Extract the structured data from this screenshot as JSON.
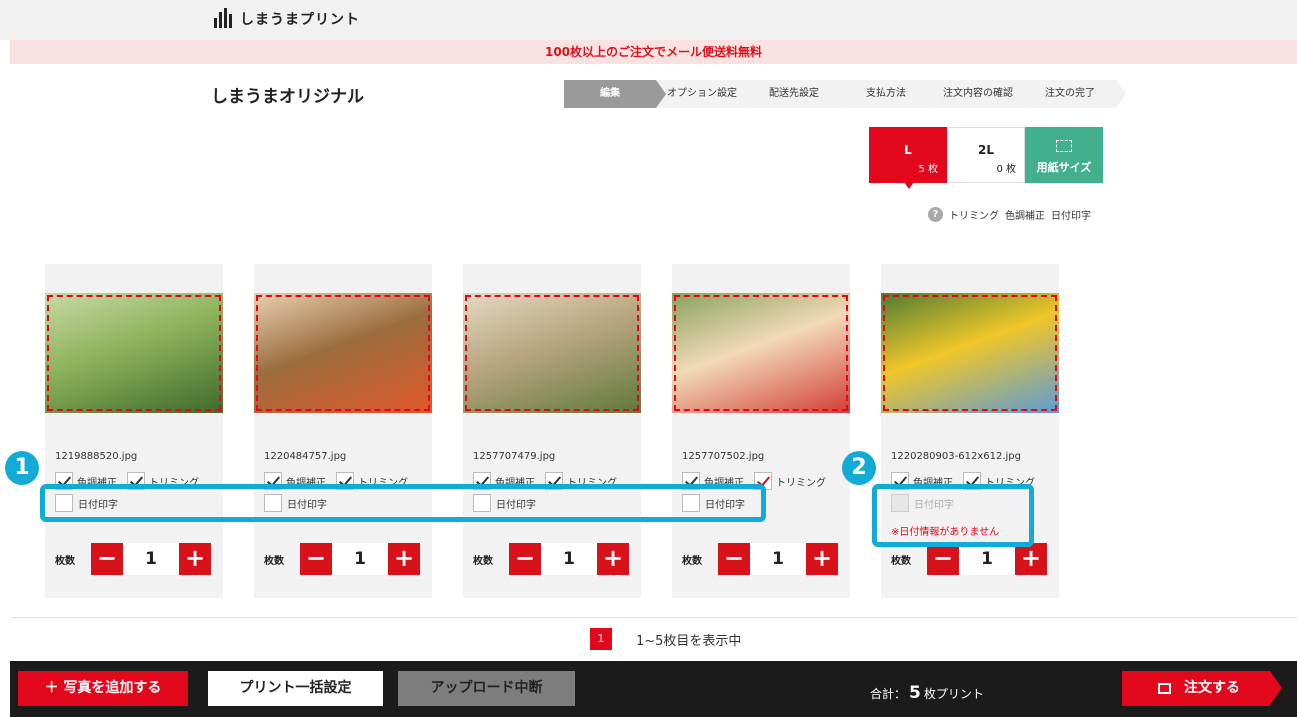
{
  "header": {
    "logo_text": "しまうまプリント"
  },
  "promo": {
    "text": "100枚以上のご注文でメール便送料無料"
  },
  "page_title": "しまうまオリジナル",
  "steps": [
    "編集",
    "オプション設定",
    "配送先設定",
    "支払方法",
    "注文内容の確認",
    "注文の完了"
  ],
  "size_tabs": [
    {
      "name": "L",
      "count": "5 枚"
    },
    {
      "name": "2L",
      "count": "0 枚"
    },
    {
      "name": "用紙サイズ"
    }
  ],
  "legend": {
    "help": "?",
    "items": [
      "トリミング",
      "色調補正",
      "日付印字"
    ]
  },
  "options_labels": {
    "color": "色調補正",
    "trim": "トリミング",
    "date": "日付印字",
    "qty": "枚数"
  },
  "photos": [
    {
      "filename": "1219888520.jpg",
      "qty": "1",
      "colors": [
        "#3f6b2c",
        "#8bb25b",
        "#c9d9a5"
      ]
    },
    {
      "filename": "1220484757.jpg",
      "qty": "1",
      "colors": [
        "#e2582a",
        "#9c6d3e",
        "#e8d1b0"
      ]
    },
    {
      "filename": "1257707479.jpg",
      "qty": "1",
      "colors": [
        "#5f7a3a",
        "#b8a57f",
        "#e3d9c2"
      ]
    },
    {
      "filename": "1257707502.jpg",
      "qty": "1",
      "colors": [
        "#d23d33",
        "#f2d9b8",
        "#87a35a"
      ]
    },
    {
      "filename": "1220280903-612x612.jpg",
      "qty": "1",
      "colors": [
        "#5c9bd6",
        "#f0c629",
        "#4e7c34"
      ],
      "no_date": "※日付情報がありません"
    }
  ],
  "callouts": [
    "1",
    "2"
  ],
  "pager": {
    "page": "1",
    "info": "1~5枚目を表示中"
  },
  "footer": {
    "add": "＋ 写真を追加する",
    "bulk": "プリント一括設定",
    "stop": "アップロード中断",
    "total_prefix": "合計：",
    "total_count": "5",
    "total_suffix": "枚プリント",
    "order": "注文する"
  },
  "colors": {
    "accent": "#e0081a",
    "paper": "#43b08d",
    "callout": "#12abd6"
  }
}
